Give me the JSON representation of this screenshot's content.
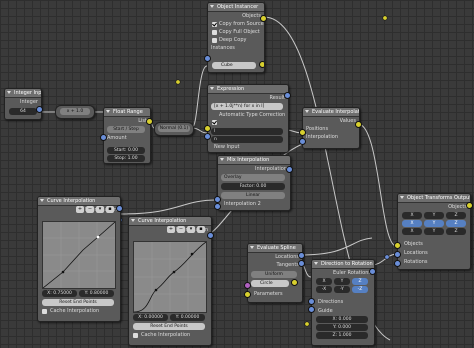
{
  "object_instancer": {
    "title": "Object Instancer",
    "out_objects": "Objects",
    "copy_from_source": "Copy from Source",
    "copy_full_object": "Copy Full Object",
    "deep_copy": "Deep Copy",
    "instances": "Instances",
    "object": "Cube"
  },
  "integer_input": {
    "title": "Integer Input",
    "label": "Integer",
    "value": "64"
  },
  "math": {
    "value": "x + 1.0"
  },
  "float_range": {
    "title": "Float Range",
    "list": "List",
    "mode": "Start / Step",
    "amount": "Amount",
    "start": "Start: 0.00",
    "step": "Stop: 1.00"
  },
  "reroute": {
    "label": "Normal (0.1)"
  },
  "expression": {
    "title": "Expression",
    "result": "Result",
    "expr": "[x + 1.0j**n) for x in l]",
    "auto_type": "Automatic Type Correction",
    "in1": "l",
    "in2": "n",
    "new_input": "New Input"
  },
  "evaluate_interp": {
    "title": "Evaluate Interpolation",
    "values": "Values",
    "positions": "Positions",
    "interpolation": "Interpolation"
  },
  "mix_interp": {
    "title": "Mix Interpolation",
    "out": "Interpolation",
    "mode": "Overlay",
    "factor": "Factor: 0.00",
    "type": "Linear",
    "in": "Interpolation 2"
  },
  "curve_interp_1": {
    "title": "Curve Interpolation",
    "out": "Interpolation",
    "x": "X: 0.75000",
    "y": "Y: 0.80000",
    "reset": "Reset End Points",
    "cache": "Cache Interpolation"
  },
  "curve_interp_2": {
    "title": "Curve Interpolation",
    "out": "Interpolation",
    "x": "X: 0.00000",
    "y": "Y: 0.00000",
    "reset": "Reset End Points",
    "cache": "Cache Interpolation"
  },
  "evaluate_spline": {
    "title": "Evaluate Spline",
    "locations": "Locations",
    "tangents": "Tangents",
    "mode": "Uniform",
    "object": "Circle",
    "parameters": "Parameters"
  },
  "direction_rotation": {
    "title": "Direction to Rotation",
    "out": "Euler Rotations",
    "axes1": [
      "X",
      "Y",
      "Z"
    ],
    "axes2": [
      "-X",
      "-Y",
      "-Z"
    ],
    "directions": "Directions",
    "guide": "Guide",
    "gx": "X: 0.000",
    "gy": "Y: 0.000",
    "gz": "Z: 1.000"
  },
  "object_transforms": {
    "title": "Object Transforms Output",
    "objects": "Objects",
    "axes": [
      "X",
      "Y",
      "Z"
    ],
    "in_objects": "Objects",
    "in_locations": "Locations",
    "in_rotations": "Rotations"
  },
  "colors": {
    "socket_yellow": "#d8d02f",
    "socket_blue": "#6a8ed8",
    "wire": "#c8c8c8"
  }
}
